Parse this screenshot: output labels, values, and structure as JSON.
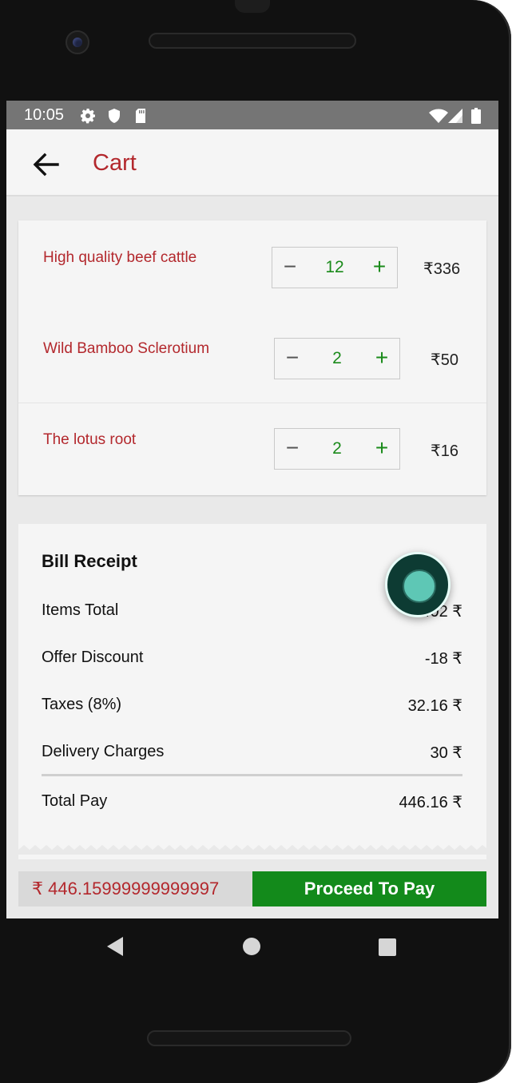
{
  "status_bar": {
    "time": "10:05",
    "icons": [
      "gear-icon",
      "shield-icon",
      "sd-card-icon",
      "wifi-icon",
      "signal-icon",
      "battery-icon"
    ]
  },
  "app_bar": {
    "title": "Cart",
    "back_icon": "arrow-left-icon"
  },
  "cart": {
    "items": [
      {
        "name": "High quality beef cattle",
        "quantity": "12",
        "price": "₹336"
      },
      {
        "name": "Wild Bamboo Sclerotium",
        "quantity": "2",
        "price": "₹50"
      },
      {
        "name": "The lotus root",
        "quantity": "2",
        "price": "₹16"
      }
    ],
    "minus_label": "−",
    "plus_label": "+"
  },
  "bill": {
    "title": "Bill Receipt",
    "lines": [
      {
        "label": "Items Total",
        "value": "402 ₹"
      },
      {
        "label": "Offer Discount",
        "value": "-18 ₹"
      },
      {
        "label": "Taxes (8%)",
        "value": "32.16 ₹"
      },
      {
        "label": "Delivery Charges",
        "value": "30 ₹"
      },
      {
        "label": "Total Pay",
        "value": "446.16 ₹"
      }
    ]
  },
  "checkout": {
    "amount": "₹ 446.15999999999997",
    "button_label": "Proceed To Pay"
  },
  "colors": {
    "accent": "#b3282d",
    "quantity": "#1a8a1a",
    "pay_button": "#138a1b"
  }
}
